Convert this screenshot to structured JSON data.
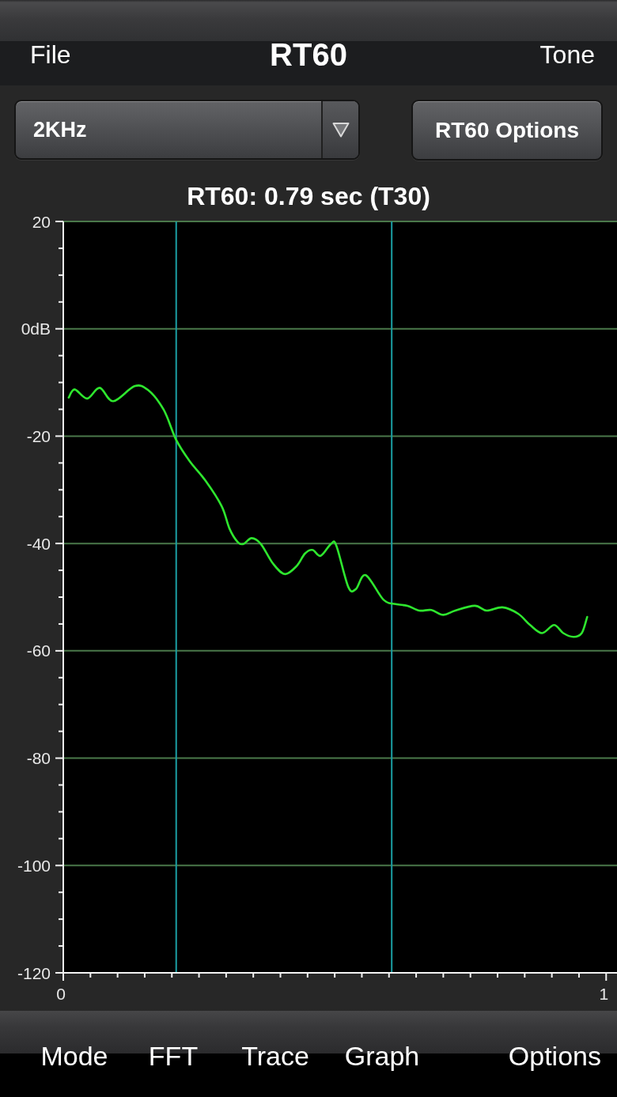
{
  "navigation_bar": {
    "left_button": "File",
    "title": "RT60",
    "right_button": "Tone"
  },
  "controls": {
    "band_dropdown": {
      "value": "2KHz"
    },
    "options_button": "RT60 Options"
  },
  "chart": {
    "chart_data": {
      "type": "line",
      "title": "RT60: 0.79 sec (T30)",
      "x": [
        0.01,
        0.021,
        0.044,
        0.067,
        0.092,
        0.131,
        0.156,
        0.185,
        0.208,
        0.233,
        0.262,
        0.292,
        0.306,
        0.321,
        0.332,
        0.347,
        0.364,
        0.386,
        0.408,
        0.43,
        0.445,
        0.459,
        0.474,
        0.493,
        0.503,
        0.525,
        0.539,
        0.557,
        0.59,
        0.612,
        0.634,
        0.656,
        0.678,
        0.7,
        0.722,
        0.758,
        0.78,
        0.809,
        0.838,
        0.86,
        0.882,
        0.904,
        0.921,
        0.94,
        0.955,
        0.965
      ],
      "series": [
        {
          "color": "#2ee62e",
          "values": [
            -12.8,
            -11.3,
            -13.0,
            -11.0,
            -13.5,
            -10.7,
            -11.4,
            -15.1,
            -20.7,
            -24.7,
            -28.3,
            -33.1,
            -37.2,
            -39.7,
            -40.1,
            -39.0,
            -40.1,
            -43.7,
            -45.7,
            -44.2,
            -41.9,
            -41.2,
            -42.3,
            -40.1,
            -40.4,
            -48.1,
            -48.5,
            -45.9,
            -50.5,
            -51.3,
            -51.6,
            -52.5,
            -52.4,
            -53.3,
            -52.5,
            -51.6,
            -52.5,
            -51.9,
            -53.1,
            -55.2,
            -56.7,
            -55.2,
            -56.7,
            -57.4,
            -56.7,
            -53.7
          ]
        }
      ],
      "xlim": [
        0,
        1.02
      ],
      "ylim": [
        -120,
        20
      ],
      "xticks": [
        0,
        1
      ],
      "yticks": [
        20,
        {
          "value": 0,
          "label": "0dB"
        },
        -20,
        -40,
        -60,
        -80,
        -100,
        -120
      ],
      "grid": true,
      "ref_lines": [
        {
          "axis": "x",
          "value": 0.208,
          "color": "#1b9ea3"
        },
        {
          "axis": "x",
          "value": 0.605,
          "color": "#1b9ea3"
        }
      ]
    }
  },
  "toolbar": {
    "items": [
      "Mode",
      "FFT",
      "Trace",
      "Graph",
      "Options"
    ]
  }
}
